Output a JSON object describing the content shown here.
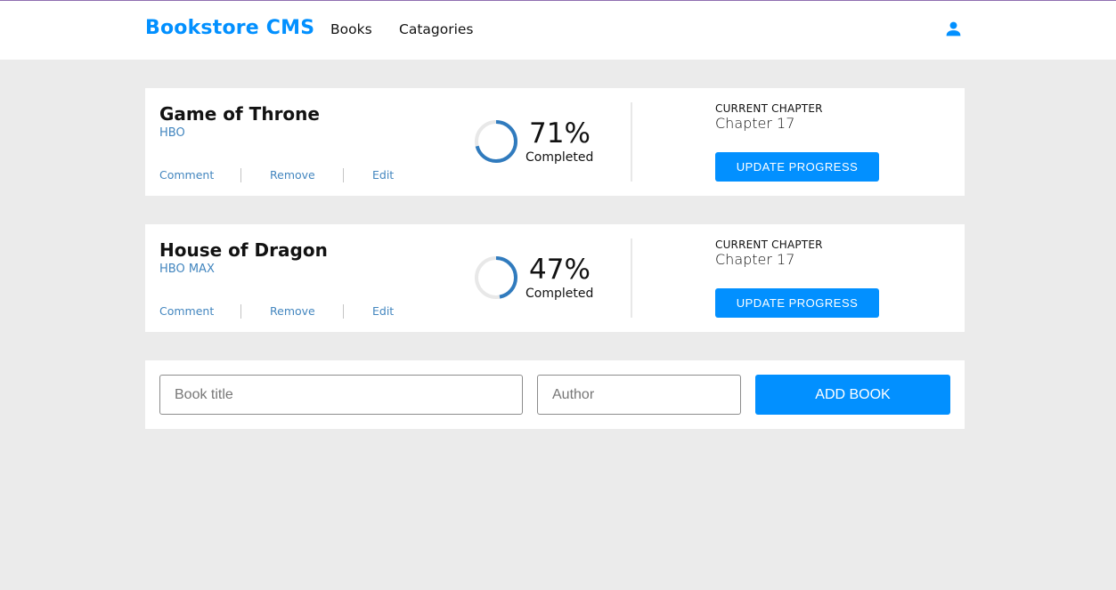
{
  "header": {
    "brand": "Bookstore CMS",
    "nav": [
      {
        "label": "Books"
      },
      {
        "label": "Catagories"
      }
    ],
    "user_icon": "user-icon",
    "accent_color": "#0290ff"
  },
  "books": [
    {
      "title": "Game of Throne",
      "author": "HBO",
      "actions": [
        "Comment",
        "Remove",
        "Edit"
      ],
      "progress_percent": 71,
      "percent_label": "71%",
      "completed_label": "Completed",
      "chapter_label": "CURRENT CHAPTER",
      "chapter_value": "Chapter 17",
      "update_label": "UPDATE PROGRESS"
    },
    {
      "title": "House of Dragon",
      "author": "HBO MAX",
      "actions": [
        "Comment",
        "Remove",
        "Edit"
      ],
      "progress_percent": 47,
      "percent_label": "47%",
      "completed_label": "Completed",
      "chapter_label": "CURRENT CHAPTER",
      "chapter_value": "Chapter 17",
      "update_label": "UPDATE PROGRESS"
    }
  ],
  "form": {
    "title_placeholder": "Book title",
    "author_placeholder": "Author",
    "add_label": "ADD BOOK"
  }
}
